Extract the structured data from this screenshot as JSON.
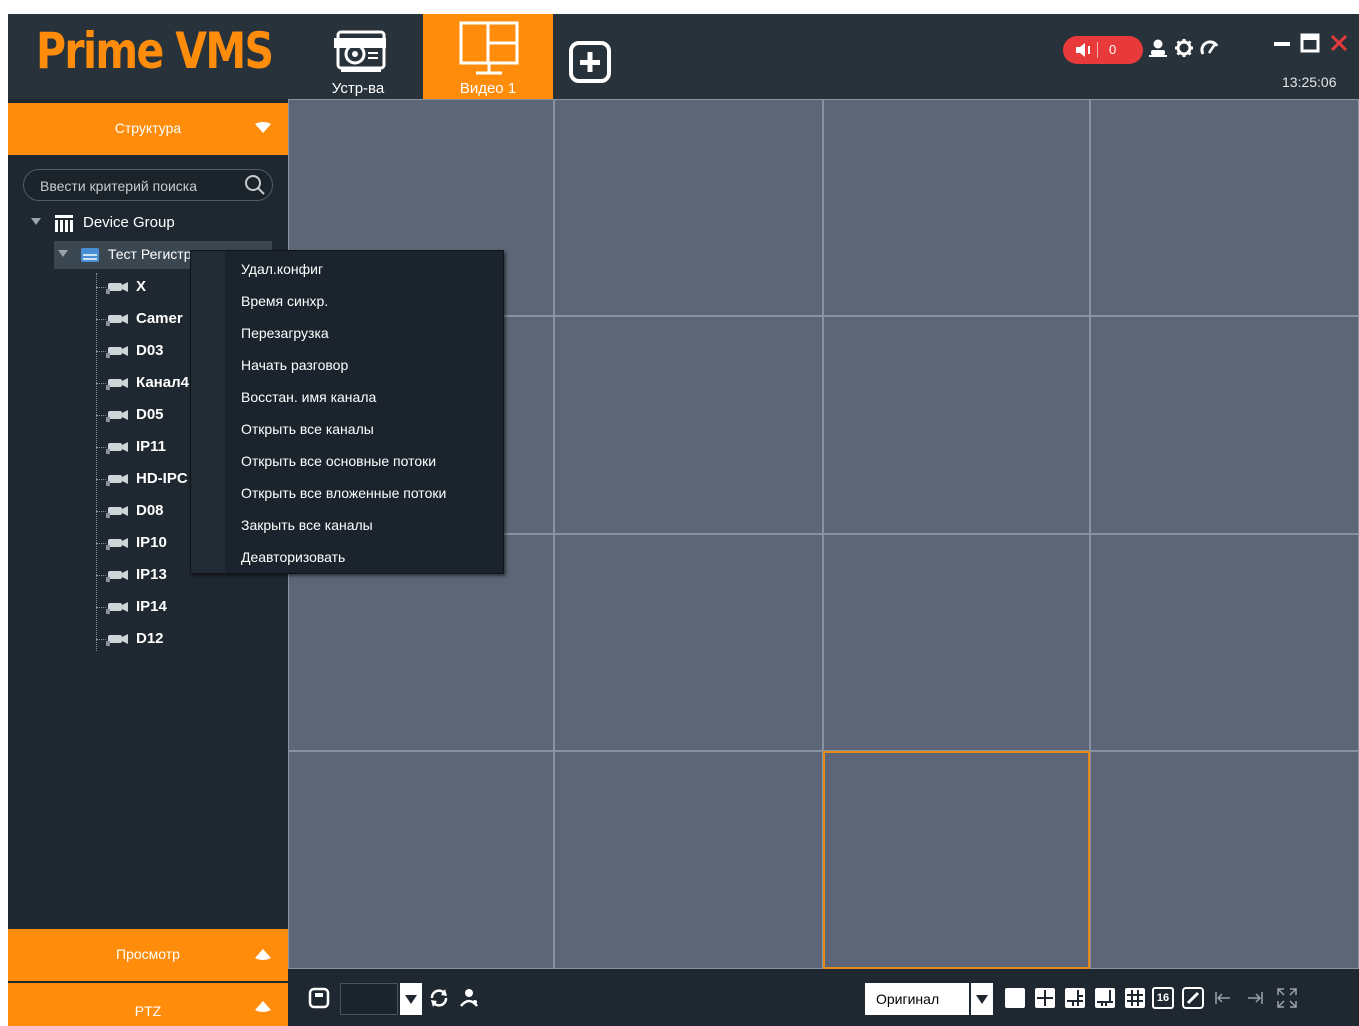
{
  "header": {
    "logo": "Prime VMS",
    "tabs": [
      {
        "label": "Устр-ва",
        "icon": "devices-icon",
        "active": false
      },
      {
        "label": "Видео 1",
        "icon": "video-layout-icon",
        "active": true
      }
    ],
    "add_tab_icon": "plus-icon",
    "alarm": {
      "icon": "speaker-icon",
      "count": "0"
    },
    "icons": [
      "user-icon",
      "gear-icon",
      "dashboard-icon"
    ],
    "window": [
      "minimize-icon",
      "maximize-icon",
      "close-icon"
    ],
    "clock": "13:25:06"
  },
  "sidebar": {
    "structure_title": "Структура",
    "search_placeholder": "Ввести критерий поиска",
    "tree": {
      "root": "Device Group",
      "device": "Тест Регистр",
      "channels": [
        "X",
        "Camer",
        "D03",
        "Канал4",
        "D05",
        "IP11",
        "HD-IPC",
        "D08",
        "IP10",
        "IP13",
        "IP14",
        "D12"
      ]
    },
    "view_title": "Просмотр",
    "ptz_title": "PTZ"
  },
  "context_menu": {
    "items": [
      "Удал.конфиг",
      "Время синхр.",
      "Перезагрузка",
      "Начать разговор",
      "Восстан. имя канала",
      "Открыть все каналы",
      "Открыть все основные потоки",
      "Открыть все вложенные потоки",
      "Закрыть все каналы",
      "Деавторизовать"
    ]
  },
  "video_grid": {
    "rows": 4,
    "cols": 4,
    "selected_cell": {
      "row": 4,
      "col": 3
    }
  },
  "bottom_bar": {
    "icons_left": [
      "save-icon",
      "dropdown-icon",
      "rotate-icon",
      "person-pin-icon"
    ],
    "stream_mode": "Оригинал",
    "layout_icons": [
      "layout-1-icon",
      "layout-4-icon",
      "layout-6-icon",
      "layout-8-icon",
      "layout-9-icon",
      "layout-16-icon",
      "custom-layout-icon",
      "prev-page-icon",
      "next-page-icon",
      "fullscreen-icon"
    ],
    "layout16_label": "16"
  },
  "colors": {
    "accent": "#ff8c0a",
    "panel": "#1f2830",
    "grid": "#5d6676",
    "alarm": "#e83a3a"
  }
}
